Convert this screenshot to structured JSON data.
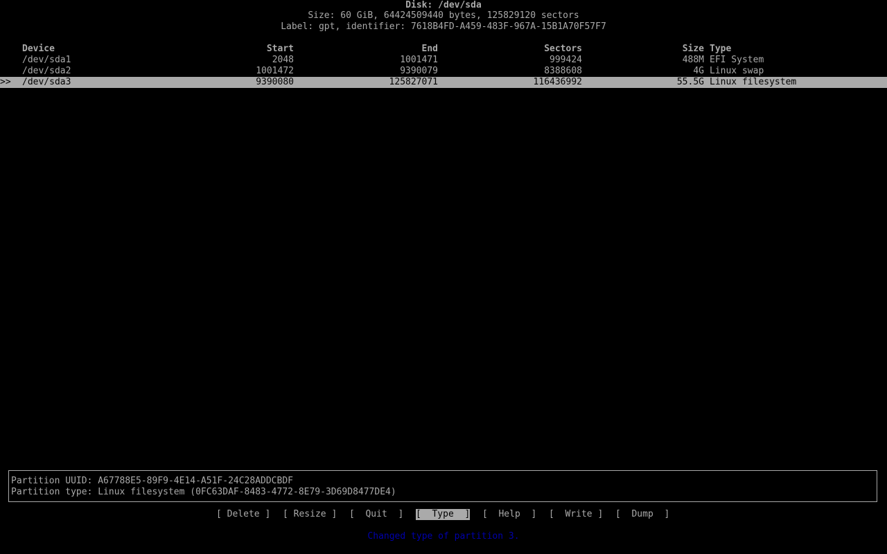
{
  "header": {
    "disk": "Disk: /dev/sda",
    "size": "Size: 60 GiB, 64424509440 bytes, 125829120 sectors",
    "label": "Label: gpt, identifier: 7618B4FD-A459-483F-967A-15B1A70F57F7"
  },
  "table": {
    "columns": {
      "device": "Device",
      "start": "Start",
      "end": "End",
      "sectors": "Sectors",
      "size": "Size",
      "type": "Type"
    },
    "rows": [
      {
        "marker": "",
        "device": "/dev/sda1",
        "start": "2048",
        "end": "1001471",
        "sectors": "999424",
        "size": "488M",
        "type": "EFI System"
      },
      {
        "marker": "",
        "device": "/dev/sda2",
        "start": "1001472",
        "end": "9390079",
        "sectors": "8388608",
        "size": "4G",
        "type": "Linux swap"
      },
      {
        "marker": ">>",
        "device": "/dev/sda3",
        "start": "9390080",
        "end": "125827071",
        "sectors": "116436992",
        "size": "55.5G",
        "type": "Linux filesystem"
      }
    ]
  },
  "info": {
    "uuid": "Partition UUID: A67788E5-89F9-4E14-A51F-24C28ADDCBDF",
    "type": "Partition type: Linux filesystem (0FC63DAF-8483-4772-8E79-3D69D8477DE4)"
  },
  "menu": {
    "delete": "[ Delete ]",
    "resize": "[ Resize ]",
    "quit": "[  Quit  ]",
    "type": "[  Type  ]",
    "help": "[  Help  ]",
    "write": "[  Write ]",
    "dump": "[  Dump  ]"
  },
  "status": "Changed type of partition 3.",
  "colors": {
    "background": "#000000",
    "text": "#aaaaaa",
    "highlight": "#aaaaaa",
    "status": "#0000aa"
  }
}
